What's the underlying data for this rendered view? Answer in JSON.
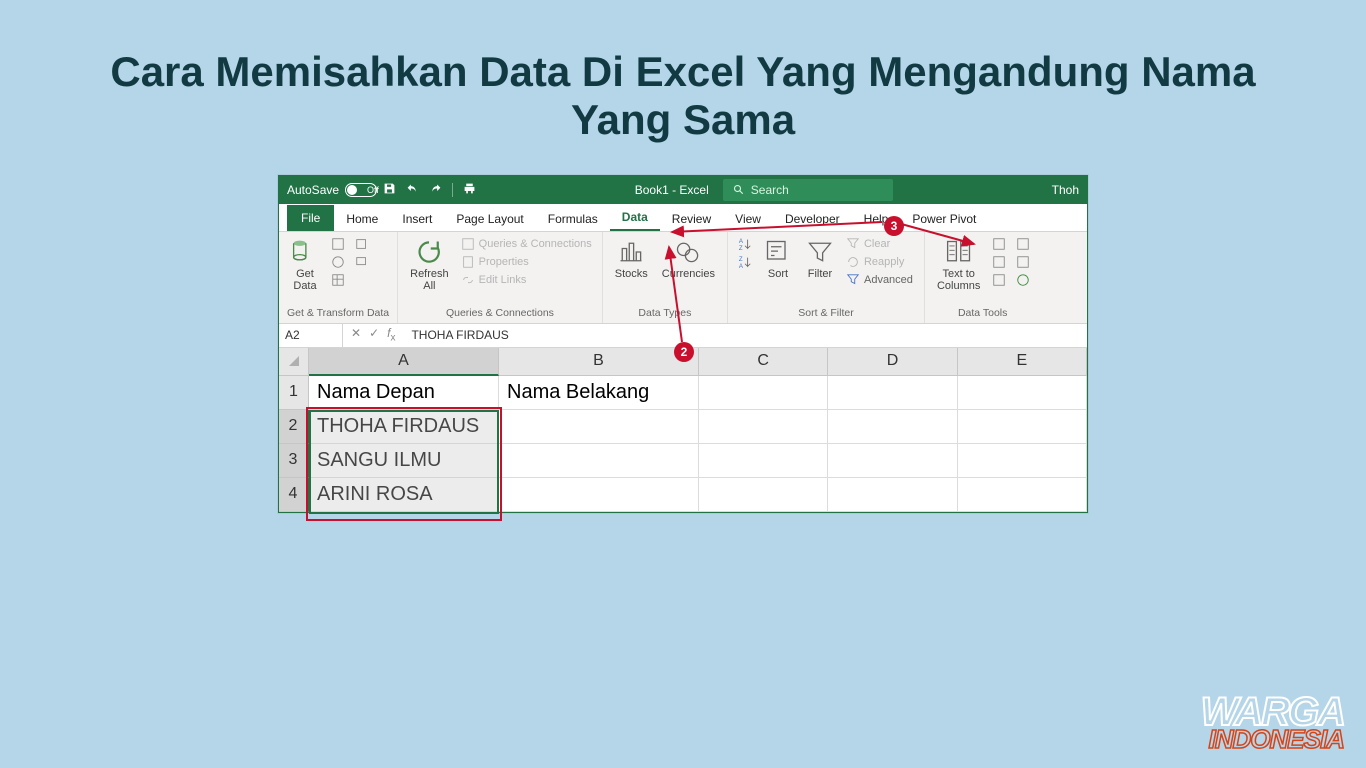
{
  "page_title": "Cara Memisahkan Data Di Excel Yang Mengandung Nama Yang Sama",
  "titlebar": {
    "autosave": "AutoSave",
    "toggle_state": "Off",
    "doc_title": "Book1 - Excel",
    "search_placeholder": "Search",
    "user": "Thoh"
  },
  "tabs": [
    "File",
    "Home",
    "Insert",
    "Page Layout",
    "Formulas",
    "Data",
    "Review",
    "View",
    "Developer",
    "Help",
    "Power Pivot"
  ],
  "active_tab": "Data",
  "ribbon": {
    "groups": {
      "get_transform": {
        "label": "Get & Transform Data",
        "get_data": "Get\nData"
      },
      "queries_conn": {
        "label": "Queries & Connections",
        "refresh": "Refresh\nAll",
        "opt1": "Queries & Connections",
        "opt2": "Properties",
        "opt3": "Edit Links"
      },
      "data_types": {
        "label": "Data Types",
        "stocks": "Stocks",
        "currencies": "Currencies"
      },
      "sort_filter": {
        "label": "Sort & Filter",
        "sort": "Sort",
        "filter": "Filter",
        "clear": "Clear",
        "reapply": "Reapply",
        "advanced": "Advanced"
      },
      "data_tools": {
        "label": "Data Tools",
        "t2c": "Text to\nColumns"
      }
    }
  },
  "formula_bar": {
    "name_box": "A2",
    "formula": "THOHA FIRDAUS"
  },
  "columns": [
    "A",
    "B",
    "C",
    "D",
    "E"
  ],
  "rows": [
    {
      "n": "1",
      "a": "Nama Depan",
      "b": "Nama Belakang"
    },
    {
      "n": "2",
      "a": "THOHA FIRDAUS",
      "b": ""
    },
    {
      "n": "3",
      "a": "SANGU ILMU",
      "b": ""
    },
    {
      "n": "4",
      "a": "ARINI ROSA",
      "b": ""
    }
  ],
  "callouts": {
    "step2": "2",
    "step3": "3"
  },
  "watermark": {
    "line1": "WARGA",
    "line2": "INDONESIA"
  }
}
